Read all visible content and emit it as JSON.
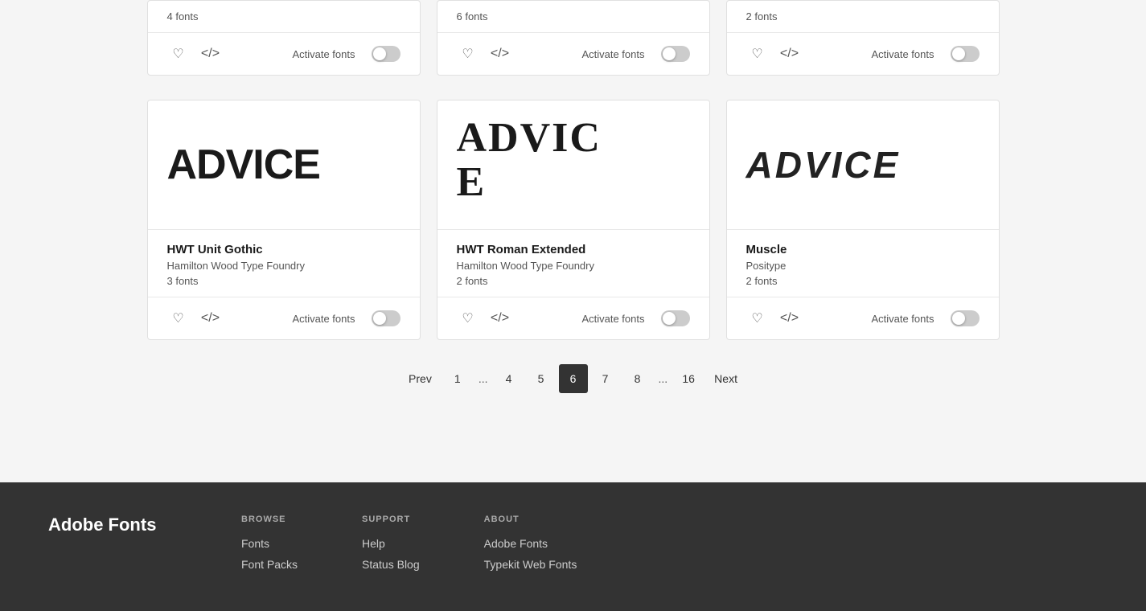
{
  "page": {
    "background": "#f5f5f5"
  },
  "topCards": [
    {
      "count": "4 fonts",
      "activateLabel": "Activate fonts"
    },
    {
      "count": "6 fonts",
      "activateLabel": "Activate fonts"
    },
    {
      "count": "2 fonts",
      "activateLabel": "Activate fonts"
    }
  ],
  "fontCards": [
    {
      "previewText": "ADVICE",
      "previewStyle": "normal",
      "fontName": "HWT Unit Gothic",
      "foundry": "Hamilton Wood Type Foundry",
      "count": "3 fonts",
      "activateLabel": "Activate fonts"
    },
    {
      "previewText": "ADVICE",
      "previewStyle": "wrap",
      "fontName": "HWT Roman Extended",
      "foundry": "Hamilton Wood Type Foundry",
      "count": "2 fonts",
      "activateLabel": "Activate fonts"
    },
    {
      "previewText": "ADVICE",
      "previewStyle": "italic",
      "fontName": "Muscle",
      "foundry": "Positype",
      "count": "2 fonts",
      "activateLabel": "Activate fonts"
    }
  ],
  "pagination": {
    "prev": "Prev",
    "next": "Next",
    "pages": [
      "1",
      "...",
      "4",
      "5",
      "6",
      "7",
      "8",
      "...",
      "16"
    ],
    "current": "6"
  },
  "footer": {
    "brand": "Adobe Fonts",
    "columns": [
      {
        "title": "BROWSE",
        "links": [
          "Fonts",
          "Font Packs"
        ]
      },
      {
        "title": "SUPPORT",
        "links": [
          "Help",
          "Status Blog"
        ]
      },
      {
        "title": "ABOUT",
        "links": [
          "Adobe Fonts",
          "Typekit Web Fonts"
        ]
      }
    ]
  }
}
